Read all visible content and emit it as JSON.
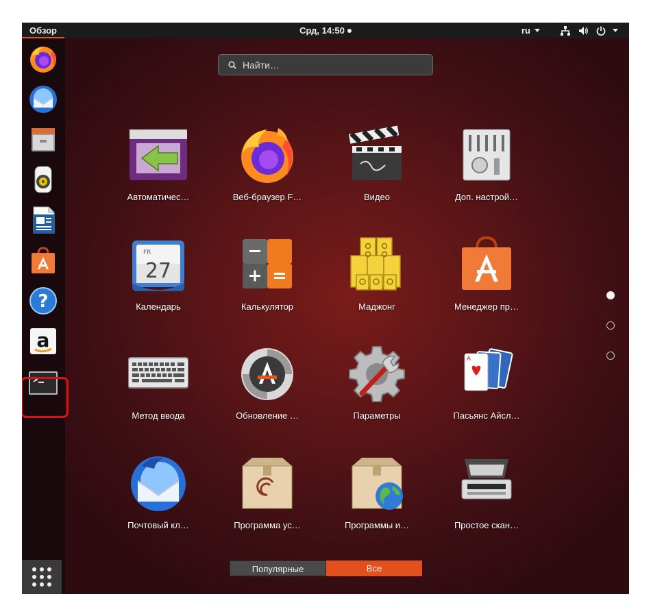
{
  "topbar": {
    "activities_label": "Обзор",
    "clock": "Срд, 14:50",
    "language": "ru"
  },
  "search": {
    "placeholder": "Найти…"
  },
  "dock": {
    "items": [
      {
        "icon": "firefox-icon"
      },
      {
        "icon": "thunderbird-icon"
      },
      {
        "icon": "files-icon"
      },
      {
        "icon": "rhythmbox-icon"
      },
      {
        "icon": "libreoffice-writer-icon"
      },
      {
        "icon": "ubuntu-software-icon"
      },
      {
        "icon": "help-icon"
      },
      {
        "icon": "amazon-icon"
      },
      {
        "icon": "terminal-icon"
      }
    ],
    "highlighted_item": "terminal-icon",
    "show_apps": "show-applications-icon"
  },
  "apps": [
    {
      "label": "Автоматичес…",
      "icon": "autostart-icon"
    },
    {
      "label": "Веб-браузер F…",
      "icon": "firefox-icon"
    },
    {
      "label": "Видео",
      "icon": "video-clapper-icon"
    },
    {
      "label": "Доп. настрой…",
      "icon": "tweaks-icon"
    },
    {
      "label": "Календарь",
      "icon": "calendar-icon",
      "day": "27",
      "weekday": "FR"
    },
    {
      "label": "Калькулятор",
      "icon": "calculator-icon"
    },
    {
      "label": "Маджонг",
      "icon": "mahjongg-icon"
    },
    {
      "label": "Менеджер пр…",
      "icon": "software-bag-icon"
    },
    {
      "label": "Метод ввода",
      "icon": "keyboard-icon"
    },
    {
      "label": "Обновление …",
      "icon": "software-updater-icon"
    },
    {
      "label": "Параметры",
      "icon": "settings-gear-icon"
    },
    {
      "label": "Пасьянс Айсл…",
      "icon": "cards-icon"
    },
    {
      "label": "Почтовый кл…",
      "icon": "thunderbird-icon"
    },
    {
      "label": "Программа ус…",
      "icon": "debian-package-icon"
    },
    {
      "label": "Программы и…",
      "icon": "software-sources-icon"
    },
    {
      "label": "Простое скан…",
      "icon": "scanner-icon"
    }
  ],
  "pager": {
    "pages": 3,
    "current": 1
  },
  "bottom_tabs": {
    "popular": "Популярные",
    "all": "Все",
    "active": "all"
  },
  "colors": {
    "accent": "#e95420",
    "highlight": "#e01010",
    "panel": "#1b1b1b"
  }
}
